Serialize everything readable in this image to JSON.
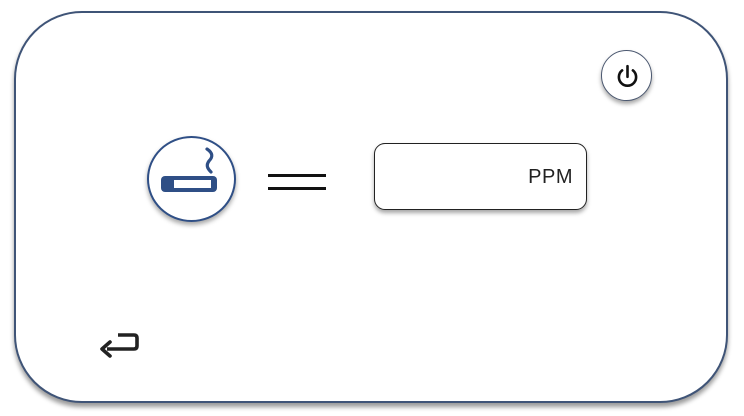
{
  "panel": {
    "border_color": "#3f5477"
  },
  "power_button": {
    "icon": "power-icon"
  },
  "sensor": {
    "icon": "smoking-icon",
    "accent_color": "#2f4f86",
    "operator_icon": "equals-icon"
  },
  "reading": {
    "value": "",
    "unit": "PPM"
  },
  "navigation": {
    "back_icon": "return-arrow-icon"
  }
}
